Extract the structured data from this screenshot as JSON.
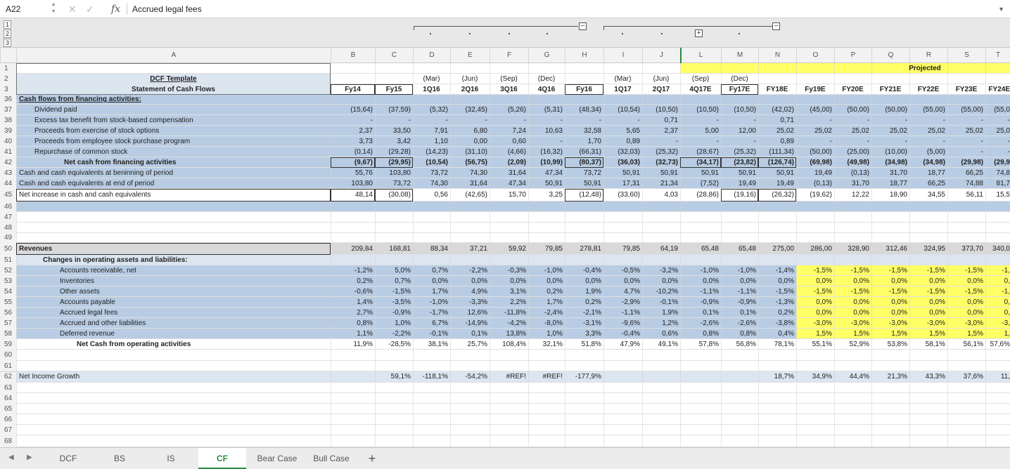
{
  "formula_bar": {
    "cell_ref": "A22",
    "fx": "fx",
    "formula": "Accrued legal fees",
    "cancel": "✕",
    "confirm": "✓"
  },
  "outline": {
    "levels": [
      "1",
      "2",
      "3"
    ],
    "expand_symbol": "+",
    "collapse_symbol": "−"
  },
  "columns": [
    "A",
    "B",
    "C",
    "D",
    "E",
    "F",
    "G",
    "H",
    "I",
    "J",
    "L",
    "M",
    "N",
    "O",
    "P",
    "Q",
    "R",
    "S",
    "T"
  ],
  "rows": [
    {
      "n": "1",
      "cells": {
        "A": "",
        "O": "",
        "R": "Projected"
      }
    },
    {
      "n": "2",
      "cells": {
        "A": "DCF Template",
        "D": "(Mar)",
        "E": "(Jun)",
        "F": "(Sep)",
        "G": "(Dec)",
        "I": "(Mar)",
        "J": "(Jun)",
        "L": "(Sep)",
        "M": "(Dec)"
      }
    },
    {
      "n": "3",
      "cells": {
        "A": "Statement of Cash Flows",
        "B": "Fy14",
        "C": "Fy15",
        "D": "1Q16",
        "E": "2Q16",
        "F": "3Q16",
        "G": "4Q16",
        "H": "Fy16",
        "I": "1Q17",
        "J": "2Q17",
        "L": "4Q17E",
        "M": "Fy17E",
        "N": "FY18E",
        "O": "Fy19E",
        "P": "FY20E",
        "Q": "FY21E",
        "R": "FY22E",
        "S": "FY23E",
        "T": "FY24E"
      }
    },
    {
      "n": "36",
      "cells": {
        "A": "Cash flows from financing activities:"
      }
    },
    {
      "n": "37",
      "cells": {
        "A": "Dividend paid",
        "B": "(15,64)",
        "C": "(37,59)",
        "D": "(5,32)",
        "E": "(32,45)",
        "F": "(5,26)",
        "G": "(5,31)",
        "H": "(48,34)",
        "I": "(10,54)",
        "J": "(10,50)",
        "L": "(10,50)",
        "M": "(10,50)",
        "N": "(42,02)",
        "O": "(45,00)",
        "P": "(50,00)",
        "Q": "(50,00)",
        "R": "(55,00)",
        "S": "(55,00)",
        "T": "(55,0"
      }
    },
    {
      "n": "38",
      "cells": {
        "A": "Excess tax benefit from stock-based compensation",
        "B": "-",
        "C": "-",
        "D": "-",
        "E": "-",
        "F": "-",
        "G": "-",
        "H": "-",
        "I": "-",
        "J": "0,71",
        "L": "-",
        "M": "-",
        "N": "0,71",
        "O": "-",
        "P": "-",
        "Q": "-",
        "R": "-",
        "S": "-",
        "T": "-"
      }
    },
    {
      "n": "39",
      "cells": {
        "A": "Proceeds from exercise of stock options",
        "B": "2,37",
        "C": "33,50",
        "D": "7,91",
        "E": "6,80",
        "F": "7,24",
        "G": "10,63",
        "H": "32,58",
        "I": "5,65",
        "J": "2,37",
        "L": "5,00",
        "M": "12,00",
        "N": "25,02",
        "O": "25,02",
        "P": "25,02",
        "Q": "25,02",
        "R": "25,02",
        "S": "25,02",
        "T": "25,0"
      }
    },
    {
      "n": "40",
      "cells": {
        "A": "Proceeds from employee stock purchase program",
        "B": "3,73",
        "C": "3,42",
        "D": "1,10",
        "E": "0,00",
        "F": "0,60",
        "G": "-",
        "H": "1,70",
        "I": "0,89",
        "J": "-",
        "L": "-",
        "M": "-",
        "N": "0,89",
        "O": "-",
        "P": "-",
        "Q": "-",
        "R": "-",
        "S": "-",
        "T": "-"
      }
    },
    {
      "n": "41",
      "cells": {
        "A": "Repurchase of common stock",
        "B": "(0,14)",
        "C": "(29,28)",
        "D": "(14,23)",
        "E": "(31,10)",
        "F": "(4,66)",
        "G": "(16,32)",
        "H": "(66,31)",
        "I": "(32,03)",
        "J": "(25,32)",
        "L": "(28,67)",
        "M": "(25,32)",
        "N": "(111,34)",
        "O": "(50,00)",
        "P": "(25,00)",
        "Q": "(10,00)",
        "R": "(5,00)",
        "S": "-",
        "T": "-"
      }
    },
    {
      "n": "42",
      "cells": {
        "A": "Net cash from financing activities",
        "B": "(9,67)",
        "C": "(29,95)",
        "D": "(10,54)",
        "E": "(56,75)",
        "F": "(2,09)",
        "G": "(10,99)",
        "H": "(80,37)",
        "I": "(36,03)",
        "J": "(32,73)",
        "L": "(34,17)",
        "M": "(23,82)",
        "N": "(126,74)",
        "O": "(69,98)",
        "P": "(49,98)",
        "Q": "(34,98)",
        "R": "(34,98)",
        "S": "(29,98)",
        "T": "(29,9"
      }
    },
    {
      "n": "43",
      "cells": {
        "A": "Cash and cash equivalents at beninning of period",
        "B": "55,76",
        "C": "103,80",
        "D": "73,72",
        "E": "74,30",
        "F": "31,64",
        "G": "47,34",
        "H": "73,72",
        "I": "50,91",
        "J": "50,91",
        "L": "50,91",
        "M": "50,91",
        "N": "50,91",
        "O": "19,49",
        "P": "(0,13)",
        "Q": "31,70",
        "R": "18,77",
        "S": "66,25",
        "T": "74,8"
      }
    },
    {
      "n": "44",
      "cells": {
        "A": "Cash and cash equivalents at end of period",
        "B": "103,80",
        "C": "73,72",
        "D": "74,30",
        "E": "31,64",
        "F": "47,34",
        "G": "50,91",
        "H": "50,91",
        "I": "17,31",
        "J": "21,34",
        "L": "(7,52)",
        "M": "19,49",
        "N": "19,49",
        "O": "(0,13)",
        "P": "31,70",
        "Q": "18,77",
        "R": "66,25",
        "S": "74,88",
        "T": "81,7"
      }
    },
    {
      "n": "45",
      "cells": {
        "A": "Net increase in cash and cash equivalents",
        "B": "48,14",
        "C": "(30,08)",
        "D": "0,56",
        "E": "(42,65)",
        "F": "15,70",
        "G": "3,25",
        "H": "(12,48)",
        "I": "(33,60)",
        "J": "4,03",
        "L": "(28,86)",
        "M": "(19,16)",
        "N": "(26,32)",
        "O": "(19,62)",
        "P": "12,22",
        "Q": "18,90",
        "R": "34,55",
        "S": "56,11",
        "T": "15,5"
      }
    },
    {
      "n": "46",
      "cells": {}
    },
    {
      "n": "47",
      "cells": {}
    },
    {
      "n": "48",
      "cells": {}
    },
    {
      "n": "49",
      "cells": {}
    },
    {
      "n": "50",
      "cells": {
        "A": "Revenues",
        "B": "209,84",
        "C": "168,81",
        "D": "88,34",
        "E": "37,21",
        "F": "59,92",
        "G": "79,85",
        "H": "278,81",
        "I": "79,85",
        "J": "64,19",
        "L": "65,48",
        "M": "65,48",
        "N": "275,00",
        "O": "286,00",
        "P": "328,90",
        "Q": "312,46",
        "R": "324,95",
        "S": "373,70",
        "T": "340,0"
      }
    },
    {
      "n": "51",
      "cells": {
        "A": "Changes in operating assets and liabilities:"
      }
    },
    {
      "n": "52",
      "cells": {
        "A": "Accounts receivable, net",
        "B": "-1,2%",
        "C": "5,0%",
        "D": "0,7%",
        "E": "-2,2%",
        "F": "-0,3%",
        "G": "-1,0%",
        "H": "-0,4%",
        "I": "-0,5%",
        "J": "-3,2%",
        "L": "-1,0%",
        "M": "-1,0%",
        "N": "-1,4%",
        "O": "-1,5%",
        "P": "-1,5%",
        "Q": "-1,5%",
        "R": "-1,5%",
        "S": "-1,5%",
        "T": "-1,"
      }
    },
    {
      "n": "53",
      "cells": {
        "A": "Inventories",
        "B": "0,2%",
        "C": "0,7%",
        "D": "0,0%",
        "E": "0,0%",
        "F": "0,0%",
        "G": "0,0%",
        "H": "0,0%",
        "I": "0,0%",
        "J": "0,0%",
        "L": "0,0%",
        "M": "0,0%",
        "N": "0,0%",
        "O": "0,0%",
        "P": "0,0%",
        "Q": "0,0%",
        "R": "0,0%",
        "S": "0,0%",
        "T": "0,"
      }
    },
    {
      "n": "54",
      "cells": {
        "A": "Other assets",
        "B": "-0,6%",
        "C": "-1,5%",
        "D": "1,7%",
        "E": "4,9%",
        "F": "3,1%",
        "G": "0,2%",
        "H": "1,9%",
        "I": "4,7%",
        "J": "-10,2%",
        "L": "-1,1%",
        "M": "-1,1%",
        "N": "-1,5%",
        "O": "-1,5%",
        "P": "-1,5%",
        "Q": "-1,5%",
        "R": "-1,5%",
        "S": "-1,5%",
        "T": "-1,"
      }
    },
    {
      "n": "55",
      "cells": {
        "A": "Accounts payable",
        "B": "1,4%",
        "C": "-3,5%",
        "D": "-1,0%",
        "E": "-3,3%",
        "F": "2,2%",
        "G": "1,7%",
        "H": "0,2%",
        "I": "-2,9%",
        "J": "-0,1%",
        "L": "-0,9%",
        "M": "-0,9%",
        "N": "-1,3%",
        "O": "0,0%",
        "P": "0,0%",
        "Q": "0,0%",
        "R": "0,0%",
        "S": "0,0%",
        "T": "0,"
      }
    },
    {
      "n": "56",
      "cells": {
        "A": "Accrued legal fees",
        "B": "2,7%",
        "C": "-0,9%",
        "D": "-1,7%",
        "E": "12,6%",
        "F": "-11,8%",
        "G": "-2,4%",
        "H": "-2,1%",
        "I": "-1,1%",
        "J": "1,9%",
        "L": "0,1%",
        "M": "0,1%",
        "N": "0,2%",
        "O": "0,0%",
        "P": "0,0%",
        "Q": "0,0%",
        "R": "0,0%",
        "S": "0,0%",
        "T": "0,"
      }
    },
    {
      "n": "57",
      "cells": {
        "A": "Accrued and other liabilities",
        "B": "0,8%",
        "C": "1,0%",
        "D": "6,7%",
        "E": "-14,9%",
        "F": "-4,2%",
        "G": "-8,0%",
        "H": "-3,1%",
        "I": "-9,6%",
        "J": "1,2%",
        "L": "-2,6%",
        "M": "-2,6%",
        "N": "-3,8%",
        "O": "-3,0%",
        "P": "-3,0%",
        "Q": "-3,0%",
        "R": "-3,0%",
        "S": "-3,0%",
        "T": "-3,"
      }
    },
    {
      "n": "58",
      "cells": {
        "A": "Deferred revenue",
        "B": "1,1%",
        "C": "-2,2%",
        "D": "-0,1%",
        "E": "0,1%",
        "F": "13,8%",
        "G": "1,0%",
        "H": "3,3%",
        "I": "-0,4%",
        "J": "0,6%",
        "L": "0,8%",
        "M": "0,8%",
        "N": "0,4%",
        "O": "1,5%",
        "P": "1,5%",
        "Q": "1,5%",
        "R": "1,5%",
        "S": "1,5%",
        "T": "1,"
      }
    },
    {
      "n": "59",
      "cells": {
        "A": "Net Cash from operating activities",
        "B": "11,9%",
        "C": "-28,5%",
        "D": "38,1%",
        "E": "25,7%",
        "F": "108,4%",
        "G": "32,1%",
        "H": "51,8%",
        "I": "47,9%",
        "J": "49,1%",
        "L": "57,8%",
        "M": "56,8%",
        "N": "78,1%",
        "O": "55,1%",
        "P": "52,9%",
        "Q": "53,8%",
        "R": "58,1%",
        "S": "56,1%",
        "T": "57,6%"
      }
    },
    {
      "n": "60",
      "cells": {}
    },
    {
      "n": "61",
      "cells": {}
    },
    {
      "n": "62",
      "cells": {
        "A": "Net Income Growth",
        "C": "59,1%",
        "D": "-118,1%",
        "E": "-54,2%",
        "F": "#REF!",
        "G": "#REF!",
        "H": "-177,9%",
        "N": "18,7%",
        "O": "34,9%",
        "P": "44,4%",
        "Q": "21,3%",
        "R": "43,3%",
        "S": "37,6%",
        "T": "11,"
      }
    },
    {
      "n": "63",
      "cells": {}
    },
    {
      "n": "64",
      "cells": {}
    },
    {
      "n": "65",
      "cells": {}
    },
    {
      "n": "66",
      "cells": {}
    },
    {
      "n": "67",
      "cells": {}
    },
    {
      "n": "68",
      "cells": {}
    }
  ],
  "sheet_tabs": [
    "DCF",
    "BS",
    "IS",
    "CF",
    "Bear Case",
    "Bull Case"
  ],
  "active_tab": "CF",
  "add_tab": "+",
  "nav": {
    "prev": "◀",
    "next": "▶"
  },
  "colors": {
    "blue": "#b8cce4",
    "yellow": "#ffff66",
    "gray": "#d9d9d9",
    "light": "#dce6f1",
    "active_green": "#2a8a3a"
  }
}
